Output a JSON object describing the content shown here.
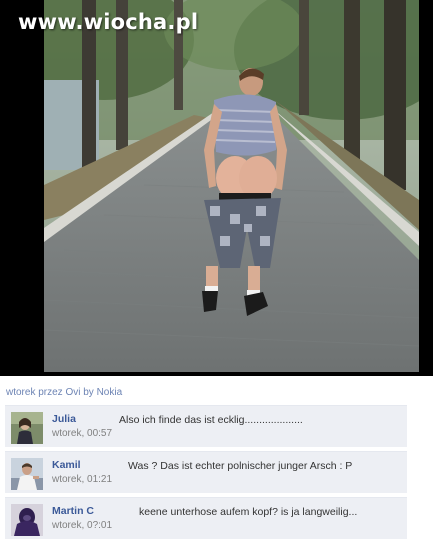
{
  "photo": {
    "watermark": "www.wiocha.pl"
  },
  "post": {
    "meta": "wtorek przez Ovi by Nokia"
  },
  "comments": [
    {
      "author": "Julia",
      "time": "wtorek, 00:57",
      "text": "Also ich finde das ist ecklig...................."
    },
    {
      "author": "Kamil",
      "time": "wtorek, 01:21",
      "text": "Was ? Das ist echter polnischer junger Arsch : P"
    },
    {
      "author": "Martin C",
      "time": "wtorek, 0?:01",
      "text": "keene unterhose aufem kopf? is ja langweilig..."
    }
  ],
  "colors": {
    "link": "#3b5998",
    "comment_bg": "#edeff4",
    "meta_link": "#6d84b4"
  }
}
